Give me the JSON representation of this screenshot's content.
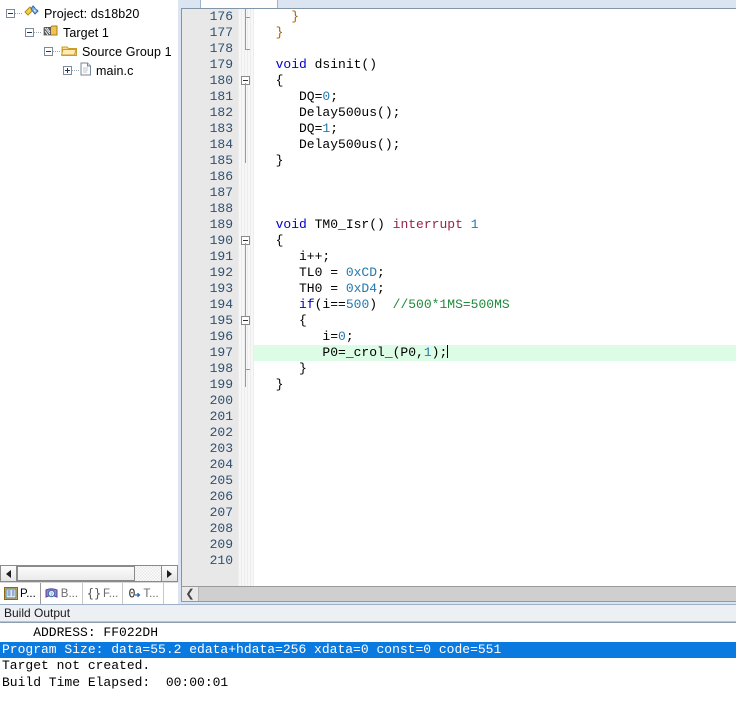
{
  "project_panel": {
    "tree": [
      {
        "label": "Project: ds18b20",
        "icon": "project-icon",
        "toggle": "minus",
        "depth": 0
      },
      {
        "label": "Target 1",
        "icon": "target-icon",
        "toggle": "minus",
        "depth": 1
      },
      {
        "label": "Source Group 1",
        "icon": "folder-icon",
        "toggle": "minus",
        "depth": 2
      },
      {
        "label": "main.c",
        "icon": "file-icon",
        "toggle": "plus",
        "depth": 3
      }
    ],
    "tabs": [
      {
        "label": "P...",
        "icon": "project-window-icon",
        "active": true
      },
      {
        "label": "B...",
        "icon": "books-icon",
        "active": false
      },
      {
        "label": "F...",
        "icon": "functions-icon",
        "active": false
      },
      {
        "label": "T...",
        "icon": "templates-icon",
        "active": false
      }
    ],
    "scroll_left_icon": "scroll-left-arrow",
    "scroll_right_icon": "scroll-right-arrow"
  },
  "editor": {
    "first_line": 176,
    "last_line": 210,
    "current_line": 197,
    "scroll_left_icon": "chevron-left-icon",
    "lines": [
      {
        "n": 176,
        "tokens": [
          {
            "t": "    ",
            "c": ""
          },
          {
            "t": "}",
            "c": "pun"
          }
        ]
      },
      {
        "n": 177,
        "tokens": [
          {
            "t": "  ",
            "c": ""
          },
          {
            "t": "}",
            "c": "pun"
          }
        ]
      },
      {
        "n": 178,
        "tokens": []
      },
      {
        "n": 179,
        "tokens": [
          {
            "t": "  ",
            "c": ""
          },
          {
            "t": "void",
            "c": "kw"
          },
          {
            "t": " dsinit()",
            "c": ""
          }
        ]
      },
      {
        "n": 180,
        "tokens": [
          {
            "t": "  {",
            "c": ""
          }
        ]
      },
      {
        "n": 181,
        "tokens": [
          {
            "t": "     DQ=",
            "c": ""
          },
          {
            "t": "0",
            "c": "num"
          },
          {
            "t": ";",
            "c": ""
          }
        ]
      },
      {
        "n": 182,
        "tokens": [
          {
            "t": "     Delay500us();",
            "c": ""
          }
        ]
      },
      {
        "n": 183,
        "tokens": [
          {
            "t": "     DQ=",
            "c": ""
          },
          {
            "t": "1",
            "c": "num"
          },
          {
            "t": ";",
            "c": ""
          }
        ]
      },
      {
        "n": 184,
        "tokens": [
          {
            "t": "     Delay500us();",
            "c": ""
          }
        ]
      },
      {
        "n": 185,
        "tokens": [
          {
            "t": "  }",
            "c": ""
          }
        ]
      },
      {
        "n": 186,
        "tokens": []
      },
      {
        "n": 187,
        "tokens": []
      },
      {
        "n": 188,
        "tokens": []
      },
      {
        "n": 189,
        "tokens": [
          {
            "t": "  ",
            "c": ""
          },
          {
            "t": "void",
            "c": "kw"
          },
          {
            "t": " TM0_Isr() ",
            "c": ""
          },
          {
            "t": "interrupt",
            "c": "irq"
          },
          {
            "t": " ",
            "c": ""
          },
          {
            "t": "1",
            "c": "num"
          }
        ]
      },
      {
        "n": 190,
        "tokens": [
          {
            "t": "  {",
            "c": ""
          }
        ]
      },
      {
        "n": 191,
        "tokens": [
          {
            "t": "     i++;",
            "c": ""
          }
        ]
      },
      {
        "n": 192,
        "tokens": [
          {
            "t": "     TL0 = ",
            "c": ""
          },
          {
            "t": "0xCD",
            "c": "num"
          },
          {
            "t": ";",
            "c": ""
          }
        ]
      },
      {
        "n": 193,
        "tokens": [
          {
            "t": "     TH0 = ",
            "c": ""
          },
          {
            "t": "0xD4",
            "c": "num"
          },
          {
            "t": ";",
            "c": ""
          }
        ]
      },
      {
        "n": 194,
        "tokens": [
          {
            "t": "     ",
            "c": ""
          },
          {
            "t": "if",
            "c": "kw"
          },
          {
            "t": "(i==",
            "c": ""
          },
          {
            "t": "500",
            "c": "num"
          },
          {
            "t": ")  ",
            "c": ""
          },
          {
            "t": "//500*1MS=500MS",
            "c": "cmt"
          }
        ]
      },
      {
        "n": 195,
        "tokens": [
          {
            "t": "     {",
            "c": ""
          }
        ]
      },
      {
        "n": 196,
        "tokens": [
          {
            "t": "        i=",
            "c": ""
          },
          {
            "t": "0",
            "c": "num"
          },
          {
            "t": ";",
            "c": ""
          }
        ]
      },
      {
        "n": 197,
        "tokens": [
          {
            "t": "        P0=_crol_(P0,",
            "c": ""
          },
          {
            "t": "1",
            "c": "num"
          },
          {
            "t": ");",
            "c": ""
          }
        ]
      },
      {
        "n": 198,
        "tokens": [
          {
            "t": "     }",
            "c": ""
          }
        ]
      },
      {
        "n": 199,
        "tokens": [
          {
            "t": "  }",
            "c": ""
          }
        ]
      },
      {
        "n": 200,
        "tokens": []
      },
      {
        "n": 201,
        "tokens": []
      },
      {
        "n": 202,
        "tokens": []
      },
      {
        "n": 203,
        "tokens": []
      },
      {
        "n": 204,
        "tokens": []
      },
      {
        "n": 205,
        "tokens": []
      },
      {
        "n": 206,
        "tokens": []
      },
      {
        "n": 207,
        "tokens": []
      },
      {
        "n": 208,
        "tokens": []
      },
      {
        "n": 209,
        "tokens": []
      },
      {
        "n": 210,
        "tokens": []
      }
    ]
  },
  "build_output": {
    "title": "Build Output",
    "lines": [
      {
        "text": "    ADDRESS: FF022DH",
        "selected": false
      },
      {
        "text": "Program Size: data=55.2 edata+hdata=256 xdata=0 const=0 code=551",
        "selected": true
      },
      {
        "text": "Target not created.",
        "selected": false
      },
      {
        "text": "Build Time Elapsed:  00:00:01",
        "selected": false
      }
    ]
  },
  "colors": {
    "keyword": "#0000c8",
    "number": "#1f7ab0",
    "comment": "#1f8a3c",
    "interrupt": "#9b2146",
    "current_line_highlight": "#ddfce6",
    "selection": "#0a7ae0"
  }
}
